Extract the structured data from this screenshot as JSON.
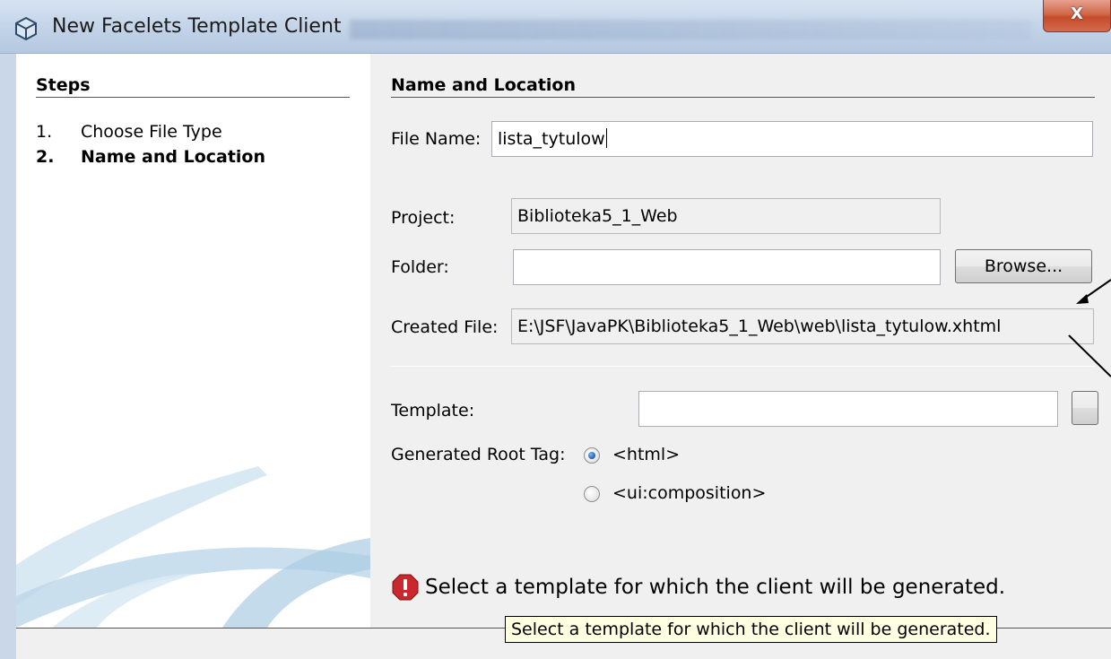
{
  "window": {
    "title": "New Facelets Template Client",
    "close_label": "X"
  },
  "steps": {
    "title": "Steps",
    "items": [
      {
        "num": "1.",
        "label": "Choose File Type",
        "current": false
      },
      {
        "num": "2.",
        "label": "Name and Location",
        "current": true
      }
    ]
  },
  "form": {
    "section_title": "Name and Location",
    "file_name_label": "File Name:",
    "file_name_value": "lista_tytulow",
    "project_label": "Project:",
    "project_value": "Biblioteka5_1_Web",
    "folder_label": "Folder:",
    "folder_value": "",
    "browse_label": "Browse...",
    "created_file_label": "Created File:",
    "created_file_value": "E:\\JSF\\JavaPK\\Biblioteka5_1_Web\\web\\lista_tytulow.xhtml",
    "template_label": "Template:",
    "template_value": "",
    "root_tag_label": "Generated Root Tag:",
    "root_tag_options": [
      {
        "label": "<html>",
        "selected": true
      },
      {
        "label": "<ui:composition>",
        "selected": false
      }
    ]
  },
  "status": {
    "error_message": "Select a template for which the client will be generated.",
    "tooltip": "Select a template for which the client will be generated."
  }
}
